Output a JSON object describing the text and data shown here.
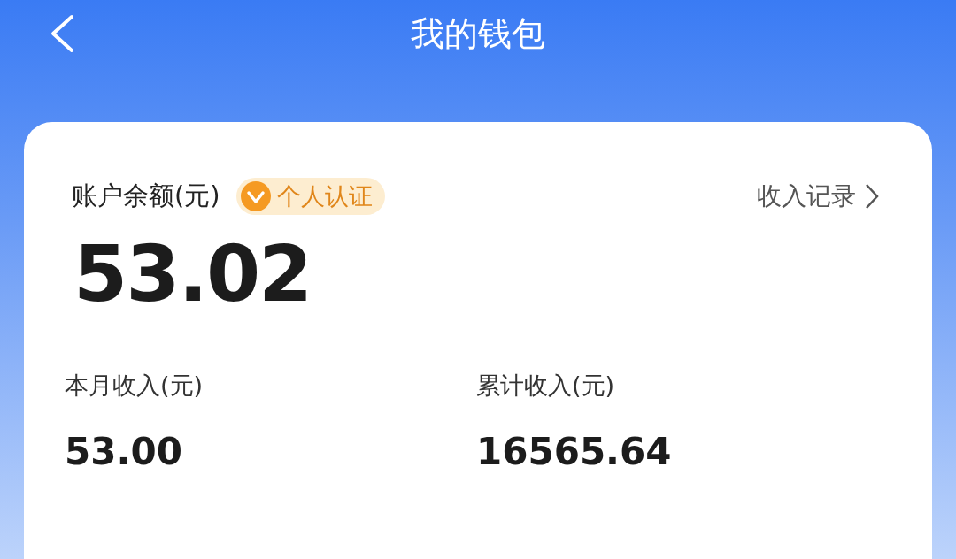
{
  "header": {
    "title": "我的钱包"
  },
  "balance": {
    "label": "账户余额(元)",
    "badge": "个人认证",
    "link": "收入记录",
    "amount": "53.02"
  },
  "stats": [
    {
      "label": "本月收入(元)",
      "value": "53.00"
    },
    {
      "label": "累计收入(元)",
      "value": "16565.64"
    }
  ]
}
